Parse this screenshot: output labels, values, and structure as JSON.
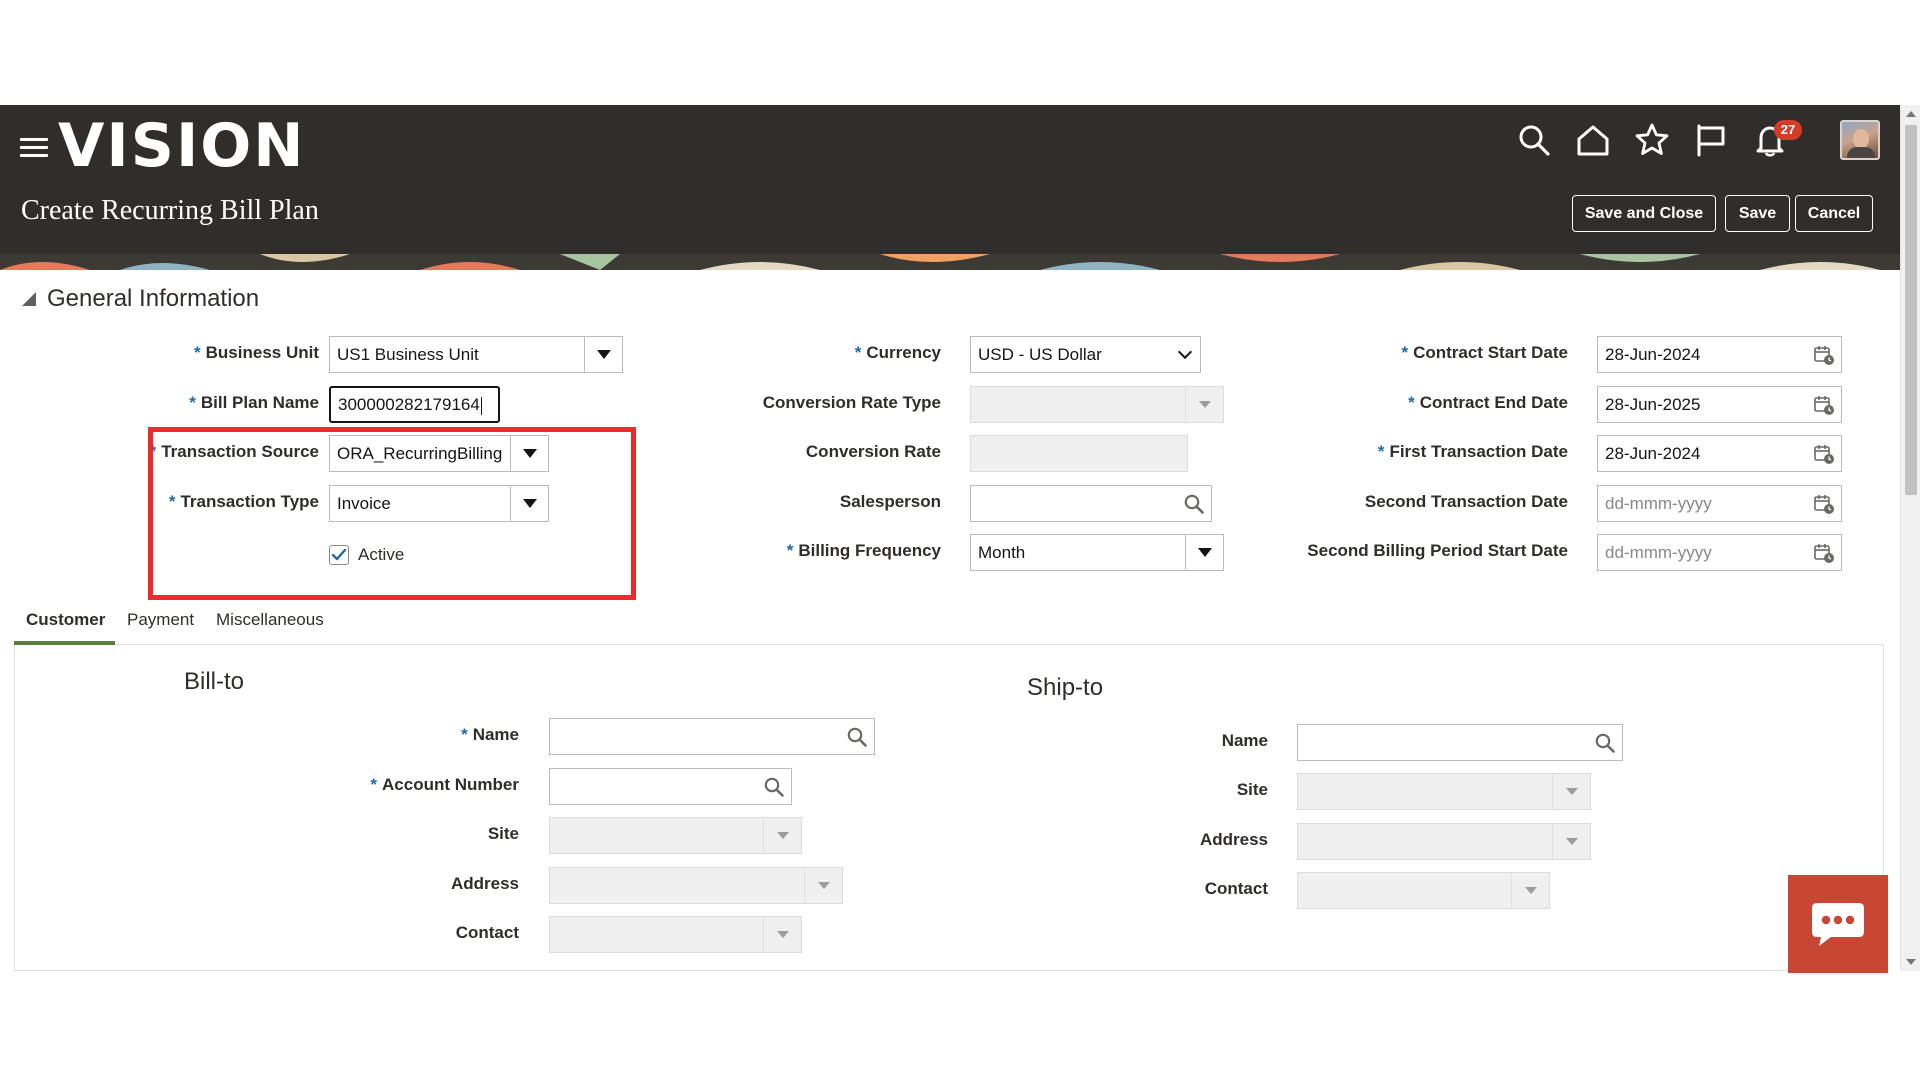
{
  "header": {
    "logo": "VISION",
    "page_title": "Create Recurring Bill Plan",
    "notification_count": "27",
    "buttons": {
      "save_and_close": "Save and Close",
      "save": "Save",
      "cancel": "Cancel"
    },
    "icons": [
      "hamburger-menu-icon",
      "search-icon",
      "home-icon",
      "star-icon",
      "flag-icon",
      "bell-icon",
      "user-avatar"
    ]
  },
  "general_information": {
    "section_title": "General Information",
    "business_unit": {
      "label": "Business Unit",
      "value": "US1 Business Unit",
      "required": true
    },
    "bill_plan_name": {
      "label": "Bill Plan Name",
      "value": "300000282179164",
      "required": true
    },
    "transaction_source": {
      "label": "Transaction Source",
      "value": "ORA_RecurringBilling",
      "required": true
    },
    "transaction_type": {
      "label": "Transaction Type",
      "value": "Invoice",
      "required": true
    },
    "active": {
      "label": "Active",
      "checked": true
    },
    "currency": {
      "label": "Currency",
      "value": "USD - US Dollar",
      "required": true
    },
    "conversion_rate_type": {
      "label": "Conversion Rate Type",
      "value": ""
    },
    "conversion_rate": {
      "label": "Conversion Rate",
      "value": ""
    },
    "salesperson": {
      "label": "Salesperson",
      "value": ""
    },
    "billing_frequency": {
      "label": "Billing Frequency",
      "value": "Month",
      "required": true
    },
    "contract_start_date": {
      "label": "Contract Start Date",
      "value": "28-Jun-2024",
      "required": true
    },
    "contract_end_date": {
      "label": "Contract End Date",
      "value": "28-Jun-2025",
      "required": true
    },
    "first_transaction_date": {
      "label": "First Transaction Date",
      "value": "28-Jun-2024",
      "required": true
    },
    "second_transaction_date": {
      "label": "Second Transaction Date",
      "placeholder": "dd-mmm-yyyy"
    },
    "second_billing_period_start_date": {
      "label": "Second Billing Period Start Date",
      "placeholder": "dd-mmm-yyyy"
    }
  },
  "tabs": [
    {
      "label": "Customer",
      "active": true
    },
    {
      "label": "Payment",
      "active": false
    },
    {
      "label": "Miscellaneous",
      "active": false
    }
  ],
  "bill_to": {
    "title": "Bill-to",
    "name": {
      "label": "Name",
      "required": true
    },
    "account_number": {
      "label": "Account Number",
      "required": true
    },
    "site": {
      "label": "Site"
    },
    "address": {
      "label": "Address"
    },
    "contact": {
      "label": "Contact"
    }
  },
  "ship_to": {
    "title": "Ship-to",
    "name": {
      "label": "Name"
    },
    "site": {
      "label": "Site"
    },
    "address": {
      "label": "Address"
    },
    "contact": {
      "label": "Contact"
    }
  },
  "colors": {
    "header_bg": "#312d2a",
    "required_star": "#1f6aa6",
    "highlight_box": "#ee2b2b",
    "active_tab": "#5c7f3b",
    "chat_fab": "#c74634",
    "badge": "#d63b25"
  }
}
